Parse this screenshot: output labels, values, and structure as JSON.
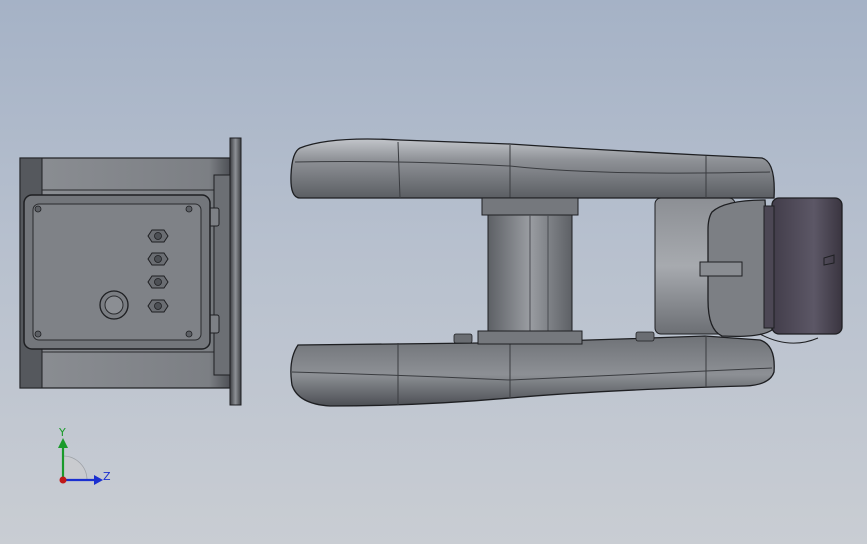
{
  "viewport": {
    "background_top": "#a5b2c6",
    "background_bottom": "#c9cdd3"
  },
  "model": {
    "part_color": "#8c8f94",
    "part_shadow": "#4a4d52",
    "edge_color": "#1e1f22",
    "motor_cap_color": "#55505e",
    "motor": {
      "connector_count": 4
    }
  },
  "triad": {
    "y_label": "Y",
    "z_label": "Z",
    "y_color": "#1a9a2a",
    "z_color": "#1a2fd0",
    "x_color": "#c01818"
  }
}
